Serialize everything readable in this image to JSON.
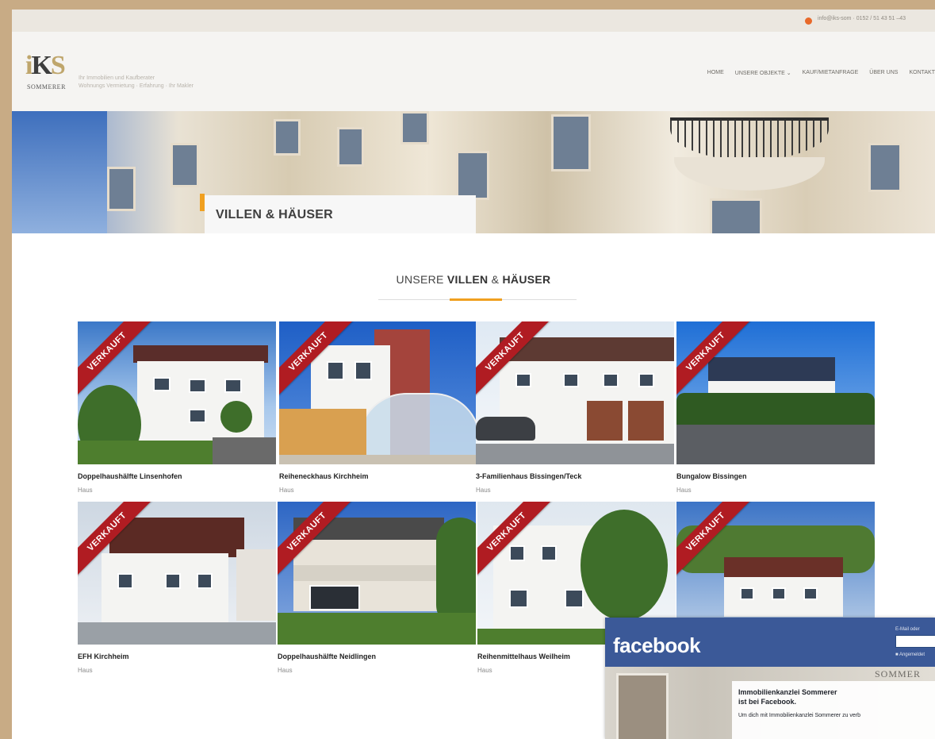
{
  "topbar": {
    "info": "info@iks-som · 0152 / 51 43 51 –43"
  },
  "logo": {
    "mark_a": "i",
    "mark_b": "K",
    "mark_c": "S",
    "name": "SOMMERER",
    "tagline_1": "Ihr Immobilien und Kaufberater",
    "tagline_2": "Wohnungs Vermietung · Erfahrung · Ihr Makler"
  },
  "nav": {
    "items": [
      "HOME",
      "UNSERE OBJEKTE ⌄",
      "KAUF/MIETANFRAGE",
      "ÜBER UNS",
      "KONTAKT"
    ]
  },
  "hero": {
    "label": "VILLEN & HÄUSER"
  },
  "section": {
    "title_pre": "UNSERE ",
    "title_b1": "VILLEN",
    "title_mid": " & ",
    "title_b2": "HÄUSER"
  },
  "ribbon": "VERKAUFT",
  "cards": [
    {
      "title": "Doppelhaushälfte Linsenhofen",
      "type": "Haus"
    },
    {
      "title": "Reiheneckhaus Kirchheim",
      "type": "Haus"
    },
    {
      "title": "3-Familienhaus Bissingen/Teck",
      "type": "Haus"
    },
    {
      "title": "Bungalow Bissingen",
      "type": "Haus"
    },
    {
      "title": "EFH Kirchheim",
      "type": "Haus"
    },
    {
      "title": "Doppelhaushälfte Neidlingen",
      "type": "Haus"
    },
    {
      "title": "Reihenmittelhaus Weilheim",
      "type": "Haus"
    },
    {
      "title": "",
      "type": ""
    }
  ],
  "facebook": {
    "logo": "facebook",
    "login_label": "E-Mail oder",
    "remember": "■ Angemeldet",
    "heading_1": "Immobilienkanzlei Sommerer",
    "heading_2": "ist bei Facebook.",
    "text": "Um dich mit Immobilienkanzlei Sommerer zu verb",
    "watermark": "SOMMER"
  },
  "colors": {
    "accent": "#f0a020",
    "ribbon": "#b01c22",
    "facebook": "#3b5998",
    "frame": "#c8ab85"
  }
}
